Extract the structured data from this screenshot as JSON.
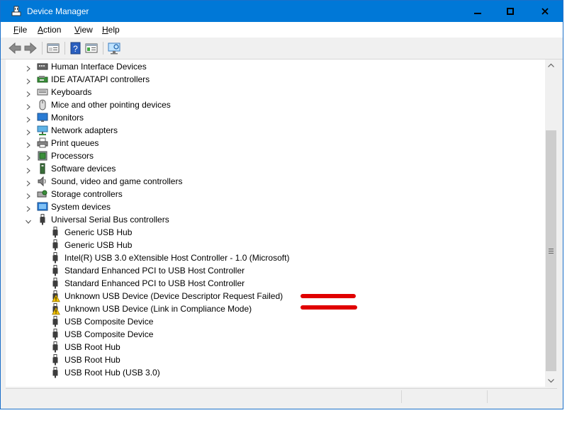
{
  "window": {
    "title": "Device Manager"
  },
  "menu": {
    "file": "File",
    "action": "Action",
    "view": "View",
    "help": "Help"
  },
  "tree": {
    "categories": [
      {
        "label": "Human Interface Devices"
      },
      {
        "label": "IDE ATA/ATAPI controllers"
      },
      {
        "label": "Keyboards"
      },
      {
        "label": "Mice and other pointing devices"
      },
      {
        "label": "Monitors"
      },
      {
        "label": "Network adapters"
      },
      {
        "label": "Print queues"
      },
      {
        "label": "Processors"
      },
      {
        "label": "Software devices"
      },
      {
        "label": "Sound, video and game controllers"
      },
      {
        "label": "Storage controllers"
      },
      {
        "label": "System devices"
      },
      {
        "label": "Universal Serial Bus controllers"
      }
    ],
    "usb_devices": [
      {
        "label": "Generic USB Hub",
        "warning": false
      },
      {
        "label": "Generic USB Hub",
        "warning": false
      },
      {
        "label": "Intel(R) USB 3.0 eXtensible Host Controller - 1.0 (Microsoft)",
        "warning": false
      },
      {
        "label": "Standard Enhanced PCI to USB Host Controller",
        "warning": false
      },
      {
        "label": "Standard Enhanced PCI to USB Host Controller",
        "warning": false
      },
      {
        "label": "Unknown USB Device (Device Descriptor Request Failed)",
        "warning": true
      },
      {
        "label": "Unknown USB Device (Link in Compliance Mode)",
        "warning": true
      },
      {
        "label": "USB Composite Device",
        "warning": false
      },
      {
        "label": "USB Composite Device",
        "warning": false
      },
      {
        "label": "USB Root Hub",
        "warning": false
      },
      {
        "label": "USB Root Hub",
        "warning": false
      },
      {
        "label": "USB Root Hub (USB 3.0)",
        "warning": false
      }
    ]
  },
  "colors": {
    "titlebar": "#0078d7",
    "annotation": "#e00000",
    "warning": "#f5c400"
  }
}
